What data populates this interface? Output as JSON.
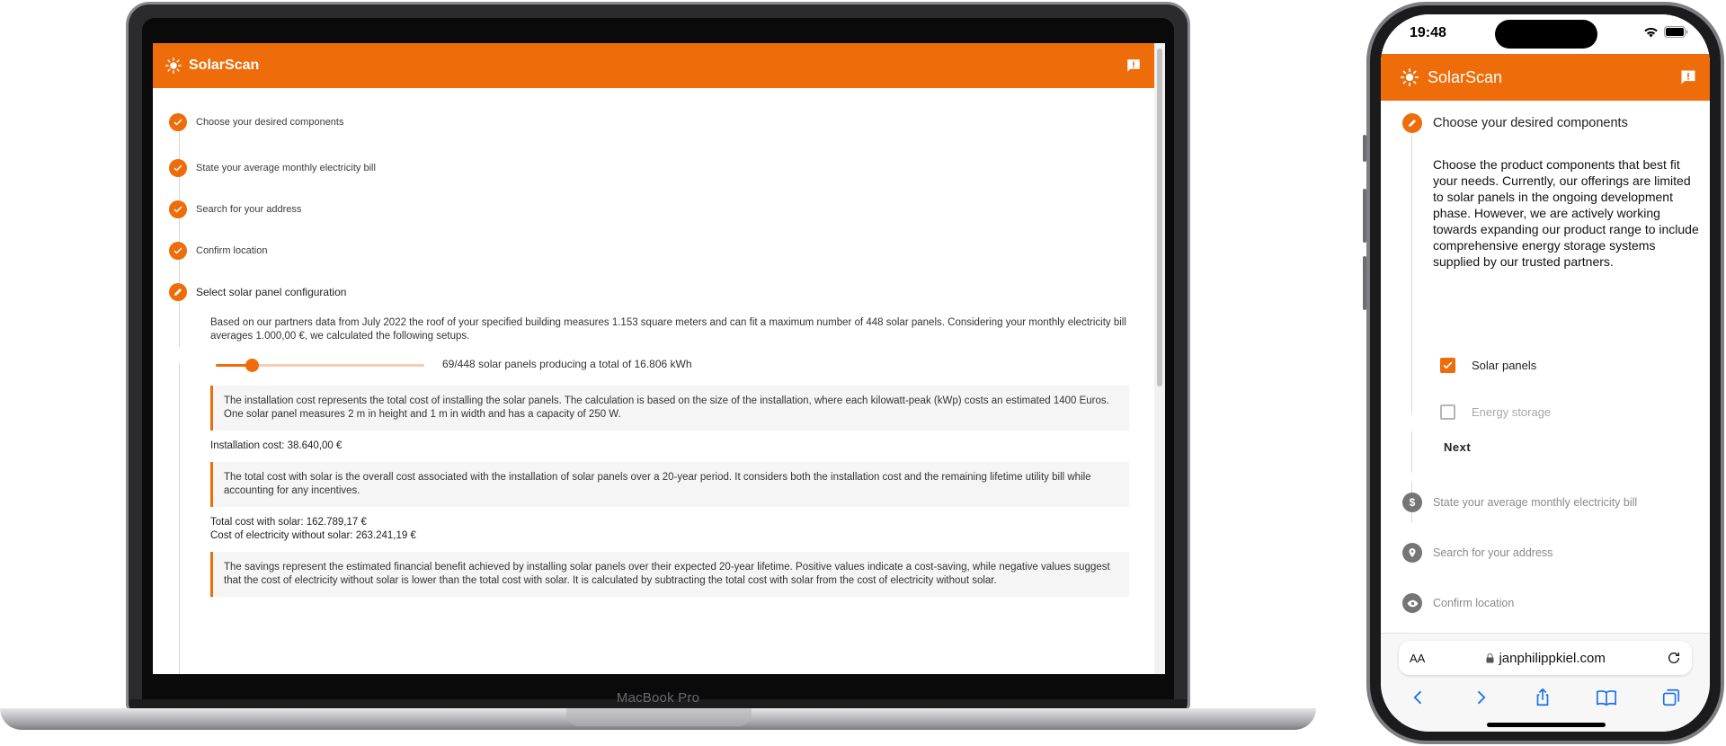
{
  "desktop": {
    "device_label": "MacBook Pro",
    "app_title": "SolarScan",
    "steps": [
      {
        "label": "Choose your desired components",
        "state": "done"
      },
      {
        "label": "State your average monthly electricity bill",
        "state": "done"
      },
      {
        "label": "Search for your address",
        "state": "done"
      },
      {
        "label": "Confirm location",
        "state": "done"
      },
      {
        "label": "Select solar panel configuration",
        "state": "active"
      }
    ],
    "intro_text": "Based on our partners data from July 2022 the roof of your specified building measures 1.153 square meters and can fit a maximum number of 448 solar panels. Considering your monthly electricity bill averages 1.000,00 €, we calculated the following setups.",
    "slider": {
      "value": 69,
      "max": 448,
      "text": "69/448 solar panels producing a total of 16.806 kWh"
    },
    "installation_note": "The installation cost represents the total cost of installing the solar panels. The calculation is based on the size of the installation, where each kilowatt-peak (kWp) costs an estimated 1400 Euros. One solar panel measures 2 m in height and 1 m in width and has a capacity of 250 W.",
    "installation_cost": "Installation cost: 38.640,00 €",
    "total_cost_note": "The total cost with solar is the overall cost associated with the installation of solar panels over a 20-year period. It considers both the installation cost and the remaining lifetime utility bill while accounting for any incentives.",
    "total_cost_with_solar": "Total cost with solar: 162.789,17 €",
    "cost_without_solar": "Cost of electricity without solar: 263.241,19 €",
    "savings_note": "The savings represent the estimated financial benefit achieved by installing solar panels over their expected 20-year lifetime. Positive values indicate a cost-saving, while negative values suggest that the cost of electricity without solar is lower than the total cost with solar. It is calculated by subtracting the total cost with solar from the cost of electricity without solar."
  },
  "mobile": {
    "status_time": "19:48",
    "app_title": "SolarScan",
    "active_step": "Choose your desired components",
    "description": "Choose the product components that best fit your needs. Currently, our offerings are limited to solar panels in the ongoing development phase. However, we are actively working towards expanding our product range to include comprehensive energy storage systems supplied by our trusted partners.",
    "options": [
      {
        "label": "Solar panels",
        "checked": true,
        "disabled": false
      },
      {
        "label": "Energy storage",
        "checked": false,
        "disabled": true
      }
    ],
    "next_label": "Next",
    "inactive_steps": [
      {
        "label": "State your average monthly electricity bill",
        "icon": "dollar-icon"
      },
      {
        "label": "Search for your address",
        "icon": "location-pin-icon"
      },
      {
        "label": "Confirm location",
        "icon": "eye-icon"
      }
    ],
    "safari": {
      "aa": "AA",
      "url": "janphilippkiel.com"
    }
  },
  "colors": {
    "accent": "#ee6c09",
    "note_bg": "#f5f5f5",
    "inactive": "#757575"
  }
}
